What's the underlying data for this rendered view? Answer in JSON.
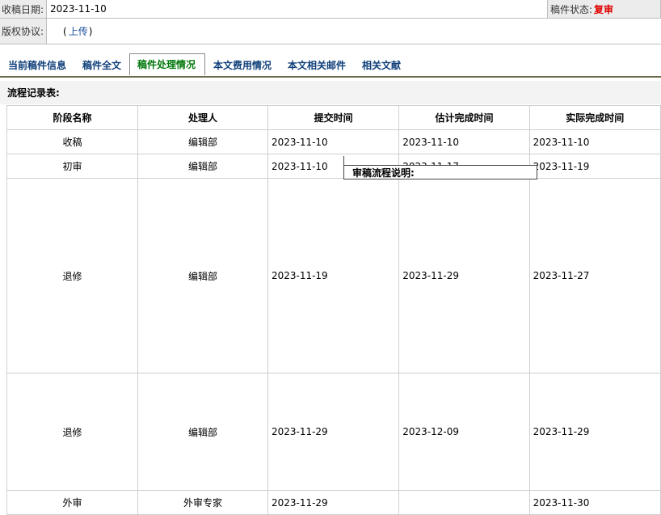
{
  "info": {
    "received_label": "收稿日期:",
    "received_value": "2023-11-10",
    "status_label": "稿件状态:",
    "status_value": "复审",
    "copyright_label": "版权协议:",
    "copyright_open": "(",
    "copyright_link": "上传",
    "copyright_close": ")"
  },
  "tabs": [
    {
      "label": "当前稿件信息"
    },
    {
      "label": "稿件全文"
    },
    {
      "label": "稿件处理情况"
    },
    {
      "label": "本文费用情况"
    },
    {
      "label": "本文相关邮件"
    },
    {
      "label": "相关文献"
    }
  ],
  "panel": {
    "title": "流程记录表:"
  },
  "table": {
    "headers": [
      "阶段名称",
      "处理人",
      "提交时间",
      "估计完成时间",
      "实际完成时间"
    ],
    "rows": [
      {
        "stage": "收稿",
        "handler": "编辑部",
        "submit": "2023-11-10",
        "est": "2023-11-10",
        "actual": "2023-11-10"
      },
      {
        "stage": "初审",
        "handler": "编辑部",
        "submit": "2023-11-10",
        "est": "2023-11-17",
        "actual": "2023-11-19"
      },
      {
        "stage": "退修",
        "handler": "编辑部",
        "submit": "2023-11-19",
        "est": "2023-11-29",
        "actual": "2023-11-27"
      },
      {
        "stage": "退修",
        "handler": "编辑部",
        "submit": "2023-11-29",
        "est": "2023-12-09",
        "actual": "2023-11-29"
      },
      {
        "stage": "外审",
        "handler": "外审专家",
        "submit": "2023-11-29",
        "est": "",
        "actual": "2023-11-30"
      }
    ]
  },
  "tooltip": {
    "text": "审稿流程说明:"
  }
}
